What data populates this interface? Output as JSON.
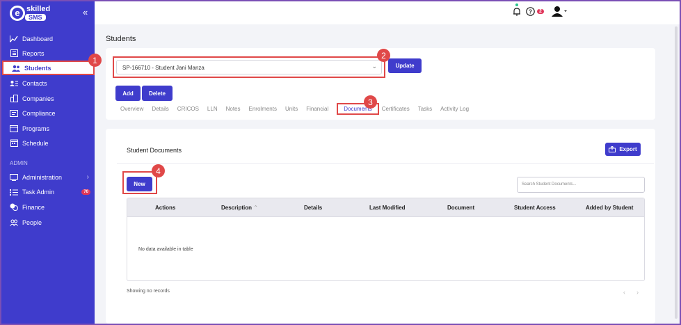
{
  "brand": {
    "e": "e",
    "name": "skilled",
    "sms": "SMS"
  },
  "sidebar": {
    "collapse": "«",
    "items": [
      {
        "label": "Dashboard",
        "icon": "chart-line-icon",
        "glyph": "⟋"
      },
      {
        "label": "Reports",
        "icon": "report-icon",
        "glyph": "▤"
      },
      {
        "label": "Students",
        "icon": "users-icon",
        "glyph": "👥"
      },
      {
        "label": "Contacts",
        "icon": "contacts-icon",
        "glyph": "☷"
      },
      {
        "label": "Companies",
        "icon": "building-icon",
        "glyph": "▥"
      },
      {
        "label": "Compliance",
        "icon": "compliance-icon",
        "glyph": "▭"
      },
      {
        "label": "Programs",
        "icon": "programs-icon",
        "glyph": "▣"
      },
      {
        "label": "Schedule",
        "icon": "calendar-icon",
        "glyph": "▦"
      }
    ],
    "section_label": "ADMIN",
    "admin_items": [
      {
        "label": "Administration",
        "icon": "admin-icon",
        "glyph": "▭"
      },
      {
        "label": "Task Admin",
        "icon": "tasks-icon",
        "glyph": "☰",
        "badge": "70"
      },
      {
        "label": "Finance",
        "icon": "finance-icon",
        "glyph": "⛁"
      },
      {
        "label": "People",
        "icon": "people-icon",
        "glyph": "☺"
      }
    ]
  },
  "topbar": {
    "help_badge": "2"
  },
  "page": {
    "title": "Students"
  },
  "student_select": {
    "value": "SP-166710 - Student Jani Manza"
  },
  "buttons": {
    "update": "Update",
    "add": "Add",
    "delete": "Delete",
    "export": "Export",
    "new": "New"
  },
  "tabs": [
    "Overview",
    "Details",
    "CRICOS",
    "LLN",
    "Notes",
    "Enrolments",
    "Units",
    "Financial",
    "Documents",
    "Certificates",
    "Tasks",
    "Activity Log"
  ],
  "active_tab": "Documents",
  "documents": {
    "title": "Student Documents",
    "search_placeholder": "Search Student Documents...",
    "columns": [
      "Actions",
      "Description",
      "Details",
      "Last Modified",
      "Document",
      "Student Access",
      "Added by Student"
    ],
    "empty": "No data available in table",
    "showing": "Showing no records",
    "prev": "‹",
    "next": "›"
  },
  "callouts": [
    "1",
    "2",
    "3",
    "4"
  ],
  "colors": {
    "primary": "#3f3ccc",
    "highlight": "#e04848"
  }
}
